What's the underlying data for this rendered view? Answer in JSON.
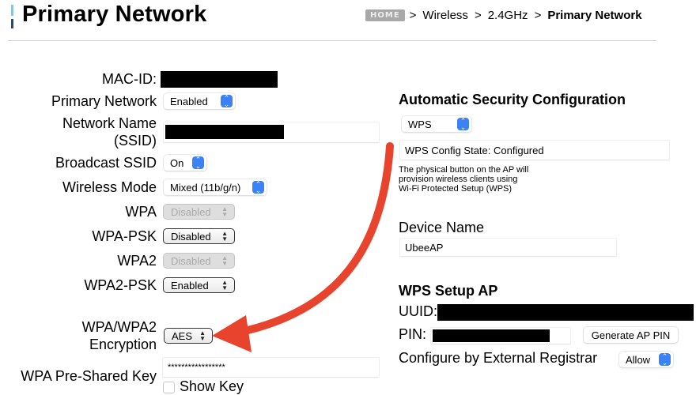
{
  "header": {
    "title": "Primary Network",
    "breadcrumb": {
      "home_label": "HOME",
      "separator": ">",
      "items": [
        "Wireless",
        "2.4GHz"
      ],
      "current": "Primary Network"
    }
  },
  "form": {
    "mac_id": {
      "label": "MAC-ID:",
      "value": "[redacted]"
    },
    "primary_network": {
      "label": "Primary Network",
      "value": "Enabled"
    },
    "network_name": {
      "label_line1": "Network Name",
      "label_line2": "(SSID)",
      "value": "[redacted]"
    },
    "broadcast_ssid": {
      "label": "Broadcast SSID",
      "value": "On"
    },
    "wireless_mode": {
      "label": "Wireless Mode",
      "value": "Mixed (11b/g/n)"
    },
    "wpa": {
      "label": "WPA",
      "value": "Disabled",
      "disabled": true
    },
    "wpa_psk": {
      "label": "WPA-PSK",
      "value": "Disabled"
    },
    "wpa2": {
      "label": "WPA2",
      "value": "Disabled",
      "disabled": true
    },
    "wpa2_psk": {
      "label": "WPA2-PSK",
      "value": "Enabled"
    },
    "encryption": {
      "label_line1": "WPA/WPA2",
      "label_line2": "Encryption",
      "value": "AES"
    },
    "psk": {
      "label": "WPA Pre-Shared Key",
      "value": "*****************"
    },
    "show_key": {
      "label": "Show Key",
      "checked": false
    }
  },
  "auto_security": {
    "heading": "Automatic Security Configuration",
    "method": "WPS",
    "config_state": "WPS Config State: Configured",
    "description_lines": [
      "The physical button on the AP will",
      "provision wireless clients using",
      "Wi-Fi Protected Setup (WPS)"
    ]
  },
  "device": {
    "heading": "Device Name",
    "value": "UbeeAP"
  },
  "wps_setup": {
    "heading": "WPS Setup AP",
    "uuid_label": "UUID:",
    "uuid_value": "[redacted]",
    "pin_label": "PIN:",
    "pin_value": "[redacted]",
    "generate_button": "Generate AP PIN",
    "registrar_label": "Configure by External Registrar",
    "registrar_value": "Allow"
  },
  "annotation": {
    "arrow_color": "#e8432d",
    "points_to": "encryption-select"
  }
}
